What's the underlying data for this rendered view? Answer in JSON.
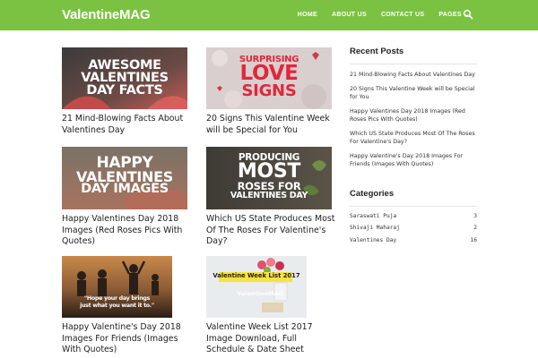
{
  "header": {
    "logo": "ValentineMAG",
    "nav": [
      {
        "label": "HOME"
      },
      {
        "label": "ABOUT US"
      },
      {
        "label": "CONTACT US"
      },
      {
        "label": "PAGES"
      }
    ],
    "pages_chevron": "⌄"
  },
  "posts": [
    {
      "title": "21 Mind-Blowing Facts About Valentines Day",
      "thumb_lines": [
        "AWESOME",
        "VALENTINES",
        "DAY FACTS"
      ]
    },
    {
      "title": "20 Signs This Valentine Week will be Special for You",
      "thumb_lines": [
        "SURPRISING",
        "LOVE",
        "SIGNS"
      ]
    },
    {
      "title": "Happy Valentines Day 2018 Images (Red Roses Pics With Quotes)",
      "thumb_lines": [
        "HAPPY",
        "VALENTINES",
        "DAY IMAGES"
      ]
    },
    {
      "title": "Which US State Produces Most Of The Roses For Valentine's Day?",
      "thumb_lines": [
        "PRODUCING",
        "MOST",
        "ROSES FOR",
        "VALENTINES DAY"
      ]
    },
    {
      "title": "Happy Valentine's Day 2018 Images For Friends (Images With Quotes)",
      "thumb_lines": [
        "\"Hope your day brings",
        "just what you want it to.\""
      ]
    },
    {
      "title": "Valentine Week List 2017 Image Download, Full Schedule & Date Sheet",
      "thumb_lines": [
        "Valentine Week List 2017",
        "ValentineMAG"
      ]
    }
  ],
  "sidebar": {
    "recent_heading": "Recent Posts",
    "recent_posts": [
      "21 Mind-Blowing Facts About Valentines Day",
      "20 Signs This Valentine Week will be Special for You",
      "Happy Valentines Day 2018 Images (Red Roses Pics With Quotes)",
      "Which US State Produces Most Of The Roses For Valentine's Day?",
      "Happy Valentine's Day 2018 Images For Friends (Images With Quotes)"
    ],
    "categories_heading": "Categories",
    "categories": [
      {
        "name": "Saraswati Puja",
        "count": "3"
      },
      {
        "name": "Shivaji Maharaj",
        "count": "2"
      },
      {
        "name": "Valentines Day",
        "count": "16"
      }
    ]
  },
  "colors": {
    "header_bg": "#7cc242",
    "sign_red": "#e3263a",
    "week_yellow": "#f6e33c"
  },
  "icons": [
    "search-icon",
    "chevron-down-icon"
  ]
}
